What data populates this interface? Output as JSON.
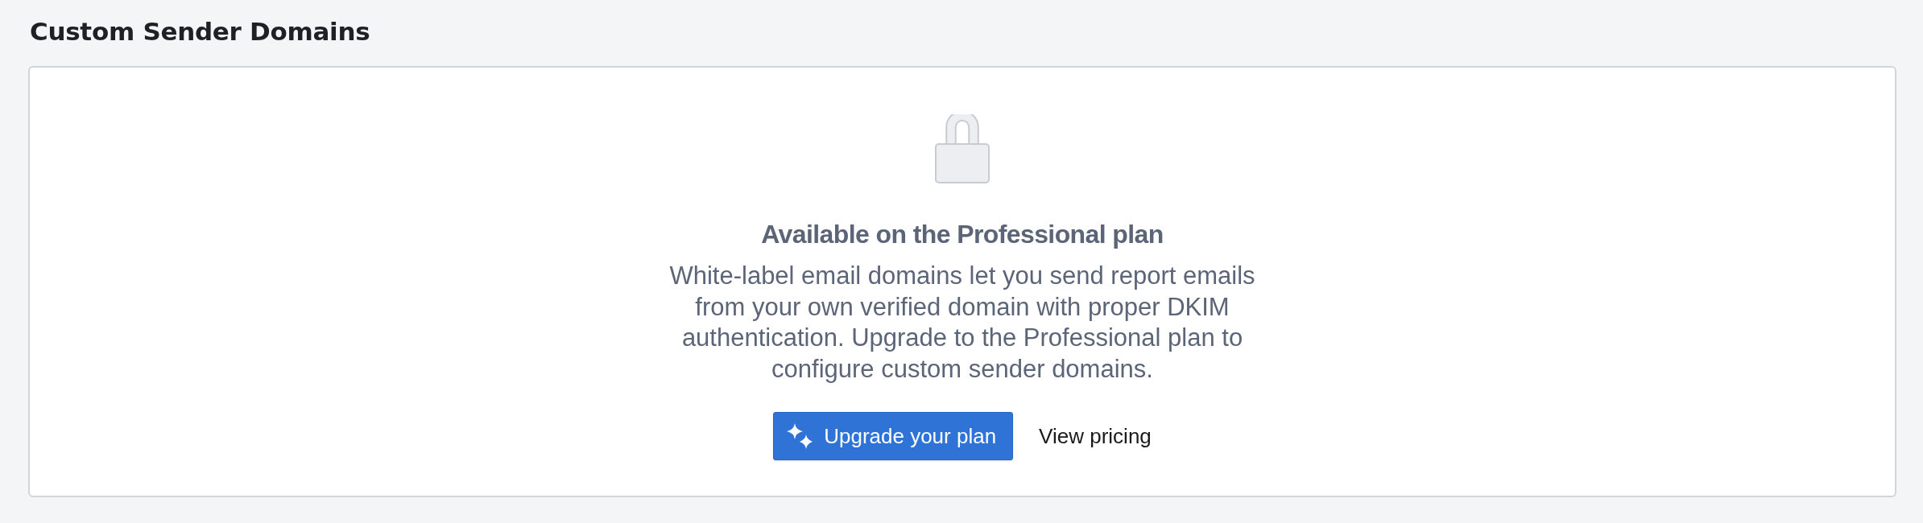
{
  "section": {
    "title": "Custom Sender Domains"
  },
  "card": {
    "heading": "Available on the Professional plan",
    "description": "White-label email domains let you send report emails from your own verified domain with proper DKIM authentication. Upgrade to the Professional plan to configure custom sender domains.",
    "buttons": [
      {
        "kind": "primary",
        "label": "Upgrade your plan"
      },
      {
        "kind": "link",
        "label": "View pricing"
      }
    ]
  }
}
